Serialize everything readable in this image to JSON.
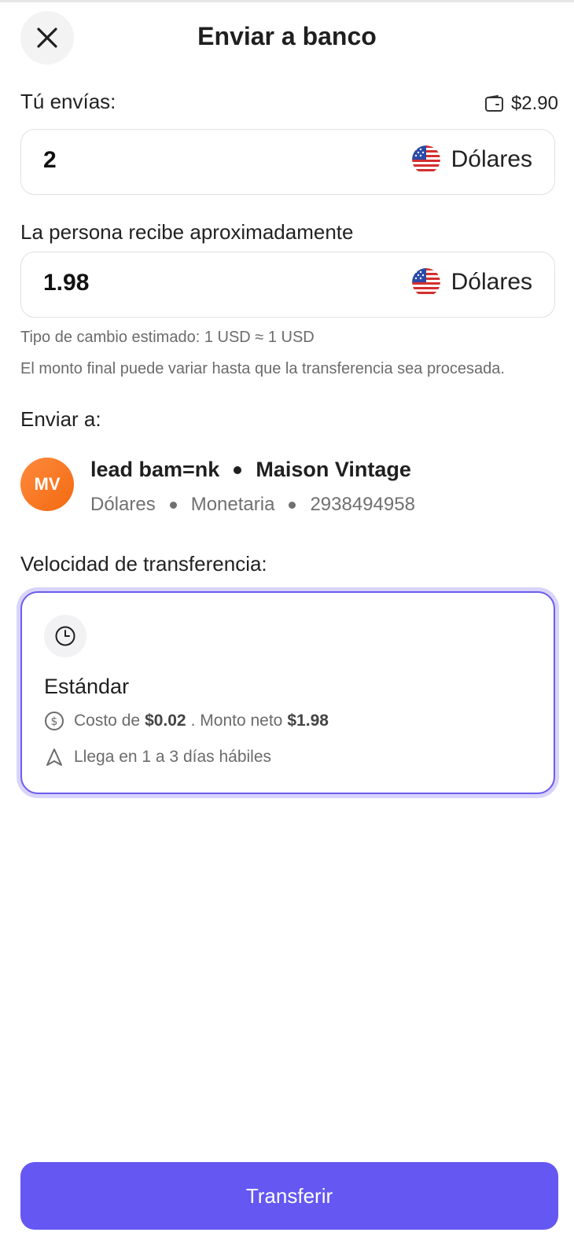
{
  "header": {
    "title": "Enviar a banco"
  },
  "send": {
    "label": "Tú envías:",
    "balance": "$2.90",
    "amount": "2",
    "currency": "Dólares"
  },
  "receive": {
    "label": "La persona recibe aproximadamente",
    "amount": "1.98",
    "currency": "Dólares",
    "rate_note": "Tipo de cambio estimado: 1 USD ≈ 1 USD",
    "disclaimer": "El monto final puede variar hasta que la transferencia sea procesada."
  },
  "recipient": {
    "section_label": "Enviar a:",
    "initials": "MV",
    "name": "lead bam=nk",
    "business": "Maison Vintage",
    "currency": "Dólares",
    "account_type": "Monetaria",
    "account_number": "2938494958"
  },
  "speed": {
    "section_label": "Velocidad de transferencia:",
    "option_title": "Estándar",
    "cost_prefix": "Costo de",
    "cost_value": "$0.02",
    "net_prefix": ". Monto neto",
    "net_value": "$1.98",
    "eta": "Llega en 1 a 3 días hábiles"
  },
  "actions": {
    "transfer_label": "Transferir"
  },
  "colors": {
    "accent": "#6457f2",
    "avatar": "#f26a10"
  }
}
